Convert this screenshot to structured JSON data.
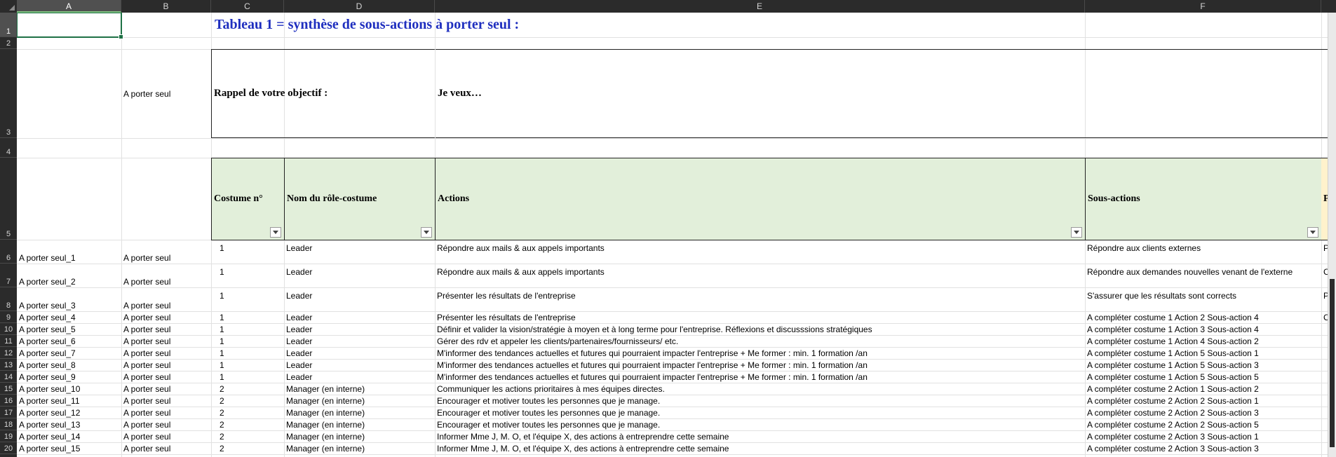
{
  "columns": [
    "A",
    "B",
    "C",
    "D",
    "E",
    "F"
  ],
  "row_numbers": [
    "1",
    "2",
    "3",
    "4",
    "5",
    "6",
    "7",
    "8",
    "9",
    "10",
    "11",
    "12",
    "13",
    "14",
    "15",
    "16",
    "17",
    "18",
    "19",
    "20"
  ],
  "title": "Tableau 1 = synthèse de sous-actions à porter seul :",
  "b3": "A porter seul",
  "objective_label": "Rappel de votre objectif :",
  "objective_value": "Je veux…",
  "headers": {
    "costume": "Costume n°",
    "role": "Nom du rôle-costume",
    "actions": "Actions",
    "sous_actions": "Sous-actions",
    "next_partial": "Po"
  },
  "rows": [
    {
      "a": "A porter seul_1",
      "b": "A porter seul",
      "c": "1",
      "d": "Leader",
      "e": "Répondre aux mails & aux appels importants",
      "f": "Répondre aux clients externes",
      "g": "Pa"
    },
    {
      "a": "A porter seul_2",
      "b": "A porter seul",
      "c": "1",
      "d": "Leader",
      "e": "Répondre aux mails & aux appels importants",
      "f": "Répondre aux demandes nouvelles venant de l'externe",
      "g": "Ca"
    },
    {
      "a": "A porter seul_3",
      "b": "A porter seul",
      "c": "1",
      "d": "Leader",
      "e": "Présenter les résultats de l'entreprise",
      "f": "S'assurer que les résultats sont corrects",
      "g": "Pa"
    },
    {
      "a": "A porter seul_4",
      "b": "A porter seul",
      "c": "1",
      "d": "Leader",
      "e": "Présenter les résultats de l'entreprise",
      "f": "A compléter costume 1 Action 2 Sous-action 4",
      "g": "Ca"
    },
    {
      "a": "A porter seul_5",
      "b": "A porter seul",
      "c": "1",
      "d": "Leader",
      "e": "Définir et valider la vision/stratégie à moyen et à long terme pour l'entreprise. Réflexions et discusssions stratégiques",
      "f": "A compléter costume 1 Action 3 Sous-action 4",
      "g": ""
    },
    {
      "a": "A porter seul_6",
      "b": "A porter seul",
      "c": "1",
      "d": "Leader",
      "e": "Gérer des rdv et appeler les clients/partenaires/fournisseurs/ etc.",
      "f": "A compléter costume 1 Action 4 Sous-action 2",
      "g": ""
    },
    {
      "a": "A porter seul_7",
      "b": "A porter seul",
      "c": "1",
      "d": "Leader",
      "e": "M'informer des tendances actuelles et futures qui pourraient impacter l'entreprise + Me former : min. 1 formation /an",
      "f": "A compléter costume 1 Action 5 Sous-action 1",
      "g": ""
    },
    {
      "a": "A porter seul_8",
      "b": "A porter seul",
      "c": "1",
      "d": "Leader",
      "e": "M'informer des tendances actuelles et futures qui pourraient impacter l'entreprise + Me former : min. 1 formation /an",
      "f": "A compléter costume 1 Action 5 Sous-action 3",
      "g": ""
    },
    {
      "a": "A porter seul_9",
      "b": "A porter seul",
      "c": "1",
      "d": "Leader",
      "e": "M'informer des tendances actuelles et futures qui pourraient impacter l'entreprise + Me former : min. 1 formation /an",
      "f": "A compléter costume 1 Action 5 Sous-action 5",
      "g": ""
    },
    {
      "a": "A porter seul_10",
      "b": "A porter seul",
      "c": "2",
      "d": "Manager (en interne)",
      "e": "Communiquer les actions prioritaires à mes équipes directes.",
      "f": "A compléter costume 2 Action 1 Sous-action 2",
      "g": ""
    },
    {
      "a": "A porter seul_11",
      "b": "A porter seul",
      "c": "2",
      "d": "Manager (en interne)",
      "e": "Encourager et motiver toutes les personnes que je manage.",
      "f": "A compléter costume 2 Action 2 Sous-action 1",
      "g": ""
    },
    {
      "a": "A porter seul_12",
      "b": "A porter seul",
      "c": "2",
      "d": "Manager (en interne)",
      "e": "Encourager et motiver toutes les personnes que je manage.",
      "f": "A compléter costume 2 Action 2 Sous-action 3",
      "g": ""
    },
    {
      "a": "A porter seul_13",
      "b": "A porter seul",
      "c": "2",
      "d": "Manager (en interne)",
      "e": "Encourager et motiver toutes les personnes que je manage.",
      "f": "A compléter costume 2 Action 2 Sous-action 5",
      "g": ""
    },
    {
      "a": "A porter seul_14",
      "b": "A porter seul",
      "c": "2",
      "d": "Manager (en interne)",
      "e": "Informer Mme J, M. O, et l'équipe X, des actions à entreprendre cette semaine",
      "f": "A compléter costume 2 Action 3 Sous-action 1",
      "g": ""
    },
    {
      "a": "A porter seul_15",
      "b": "A porter seul",
      "c": "2",
      "d": "Manager (en interne)",
      "e": "Informer Mme J, M. O, et l'équipe X, des actions à entreprendre cette semaine",
      "f": "A compléter costume 2 Action 3 Sous-action 3",
      "g": ""
    }
  ]
}
